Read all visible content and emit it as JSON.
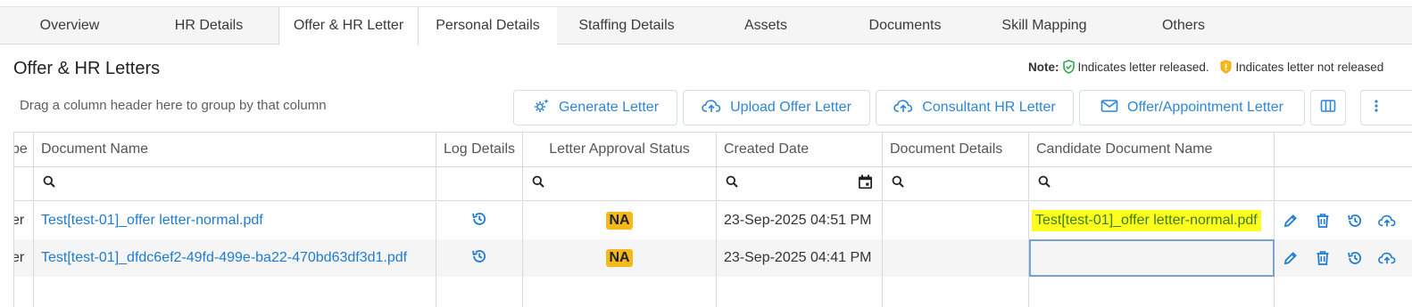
{
  "tabs": [
    "Overview",
    "HR Details",
    "Offer & HR Letter",
    "Personal Details",
    "Staffing Details",
    "Assets",
    "Documents",
    "Skill Mapping",
    "Others"
  ],
  "section_title": "Offer & HR Letters",
  "note": {
    "label": "Note:",
    "released": "Indicates letter released.",
    "not_released": "Indicates letter not released"
  },
  "drag_hint": "Drag a column header here to group by that column",
  "toolbar": {
    "generate": "Generate Letter",
    "upload_offer": "Upload Offer Letter",
    "consultant": "Consultant HR Letter",
    "offer_appointment": "Offer/Appointment Letter"
  },
  "columns": {
    "type": "pe",
    "document_name": "Document Name",
    "log_details": "Log Details",
    "approval": "Letter Approval Status",
    "created": "Created Date",
    "doc_details": "Document Details",
    "candidate_doc": "Candidate Document Name"
  },
  "rows": [
    {
      "type": "er",
      "document_name": "Test[test-01]_offer letter-normal.pdf",
      "approval": "NA",
      "created": "23-Sep-2025 04:51 PM",
      "candidate_doc": "Test[test-01]_offer letter-normal.pdf"
    },
    {
      "type": "er",
      "document_name": "Test[test-01]_dfdc6ef2-49fd-499e-ba22-470bd63df3d1.pdf",
      "approval": "NA",
      "created": "23-Sep-2025 04:41 PM",
      "candidate_doc": ""
    }
  ],
  "colors": {
    "accent": "#2e86d6",
    "link": "#1e7bd0",
    "badge": "#f5b91a",
    "highlight": "#ffff1f",
    "released_icon": "#2fa84f",
    "not_released_icon": "#f5b91a"
  },
  "icons": [
    "check-shield-icon",
    "warning-shield-icon",
    "gear-sparkle-icon",
    "cloud-upload-icon",
    "mail-icon",
    "columns-icon",
    "more-vertical-icon",
    "search-icon",
    "calendar-icon",
    "history-icon",
    "edit-icon",
    "delete-icon"
  ]
}
